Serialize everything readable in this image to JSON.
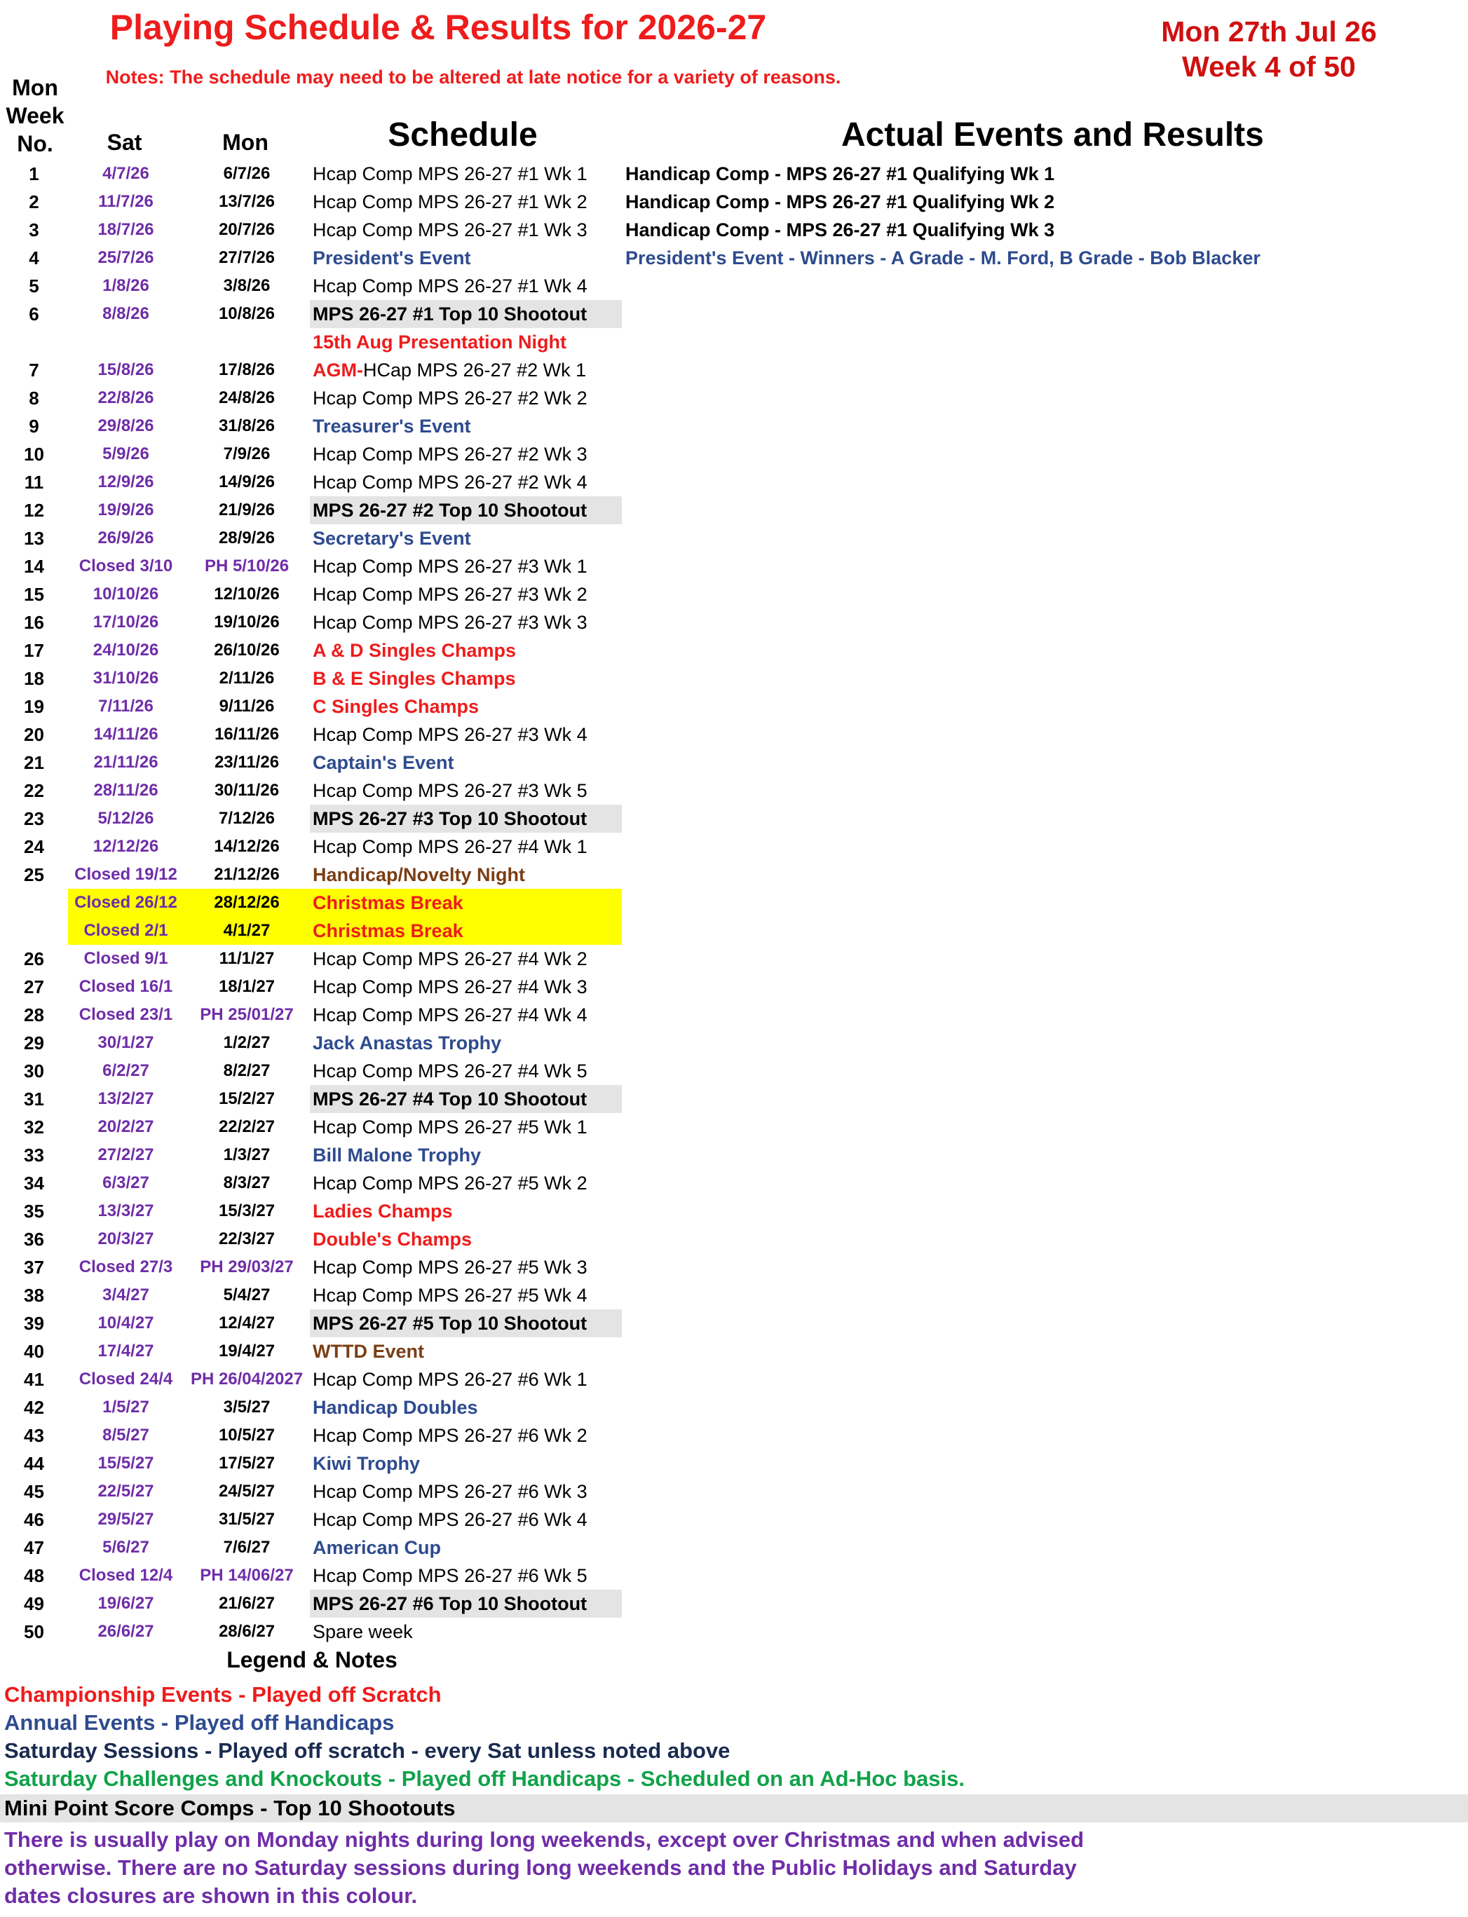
{
  "header": {
    "title": "Playing Schedule & Results for 2026-27",
    "notes": "Notes: The schedule may need to be altered at late notice for a variety of reasons.",
    "date_line1": "Mon 27th Jul 26",
    "date_line2": "Week 4 of 50"
  },
  "columns": {
    "week": "Mon Week No.",
    "sat": "Sat",
    "mon": "Mon",
    "schedule": "Schedule",
    "results": "Actual Events and Results"
  },
  "colors": {
    "championship": "#ee1c1c",
    "annual": "#2e4b8f",
    "saturday_sessions": "#1a2b50",
    "challenges": "#11a24a",
    "closures": "#6f2da8",
    "highlight_grey": "#e4e4e4",
    "highlight_yellow": "#ffff00"
  },
  "rows": [
    {
      "wk": "1",
      "sat": "4/7/26",
      "mon": "6/7/26",
      "sch": "Hcap Comp MPS 26-27 #1 Wk 1",
      "sch_style": "normal",
      "res": "Handicap Comp - MPS 26-27 #1 Qualifying Wk 1",
      "res_style": "bold"
    },
    {
      "wk": "2",
      "sat": "11/7/26",
      "mon": "13/7/26",
      "sch": "Hcap Comp MPS 26-27 #1 Wk 2",
      "sch_style": "normal",
      "res": "Handicap Comp - MPS 26-27 #1 Qualifying Wk 2",
      "res_style": "bold"
    },
    {
      "wk": "3",
      "sat": "18/7/26",
      "mon": "20/7/26",
      "sch": "Hcap Comp MPS 26-27 #1 Wk 3",
      "sch_style": "normal",
      "res": "Handicap Comp - MPS 26-27 #1 Qualifying Wk 3",
      "res_style": "bold"
    },
    {
      "wk": "4",
      "sat": "25/7/26",
      "mon": "27/7/26",
      "sch": "President's Event",
      "sch_style": "blue",
      "res": "President's Event - Winners - A Grade - M. Ford, B Grade - Bob Blacker",
      "res_style": "blue"
    },
    {
      "wk": "5",
      "sat": "1/8/26",
      "mon": "3/8/26",
      "sch": "Hcap Comp MPS 26-27 #1 Wk 4",
      "sch_style": "normal",
      "res": "",
      "res_style": "bold"
    },
    {
      "wk": "6",
      "sat": "8/8/26",
      "mon": "10/8/26",
      "sch": "MPS 26-27 #1 Top 10 Shootout",
      "sch_style": "bold",
      "hl": "grey",
      "res": "",
      "res_style": "bold"
    },
    {
      "wk": "",
      "sat": "",
      "mon": "",
      "sch": "15th Aug Presentation Night",
      "sch_style": "red",
      "res": "",
      "res_style": "bold"
    },
    {
      "wk": "7",
      "sat": "15/8/26",
      "mon": "17/8/26",
      "sch": "AGM-",
      "sch_style": "red",
      "sch2": "HCap MPS 26-27 #2 Wk 1",
      "res": "",
      "res_style": "bold"
    },
    {
      "wk": "8",
      "sat": "22/8/26",
      "mon": "24/8/26",
      "sch": "Hcap Comp MPS 26-27 #2 Wk 2",
      "sch_style": "normal",
      "res": "",
      "res_style": "bold"
    },
    {
      "wk": "9",
      "sat": "29/8/26",
      "mon": "31/8/26",
      "sch": "Treasurer's Event",
      "sch_style": "blue",
      "res": "",
      "res_style": "bold"
    },
    {
      "wk": "10",
      "sat": "5/9/26",
      "mon": "7/9/26",
      "sch": "Hcap Comp MPS 26-27 #2 Wk 3",
      "sch_style": "normal",
      "res": "",
      "res_style": "bold"
    },
    {
      "wk": "11",
      "sat": "12/9/26",
      "mon": "14/9/26",
      "sch": "Hcap Comp MPS 26-27 #2 Wk 4",
      "sch_style": "normal",
      "res": "",
      "res_style": "bold"
    },
    {
      "wk": "12",
      "sat": "19/9/26",
      "mon": "21/9/26",
      "sch": "MPS 26-27 #2 Top 10 Shootout",
      "sch_style": "bold",
      "hl": "grey",
      "res": "",
      "res_style": "bold"
    },
    {
      "wk": "13",
      "sat": "26/9/26",
      "mon": "28/9/26",
      "sch": "Secretary's Event",
      "sch_style": "blue",
      "res": "",
      "res_style": "bold"
    },
    {
      "wk": "14",
      "sat": "Closed 3/10",
      "mon": "PH 5/10/26",
      "mon_style": "purple",
      "sch": "Hcap Comp MPS 26-27 #3 Wk 1",
      "sch_style": "normal",
      "res": "",
      "res_style": "bold"
    },
    {
      "wk": "15",
      "sat": "10/10/26",
      "mon": "12/10/26",
      "sch": "Hcap Comp MPS 26-27 #3 Wk 2",
      "sch_style": "normal",
      "res": "",
      "res_style": "bold"
    },
    {
      "wk": "16",
      "sat": "17/10/26",
      "mon": "19/10/26",
      "sch": "Hcap Comp MPS 26-27 #3 Wk 3",
      "sch_style": "normal",
      "res": "",
      "res_style": "bold"
    },
    {
      "wk": "17",
      "sat": "24/10/26",
      "mon": "26/10/26",
      "sch": "A & D Singles Champs",
      "sch_style": "red",
      "res": "",
      "res_style": "bold"
    },
    {
      "wk": "18",
      "sat": "31/10/26",
      "mon": "2/11/26",
      "sch": "B & E Singles Champs",
      "sch_style": "red",
      "res": "",
      "res_style": "bold"
    },
    {
      "wk": "19",
      "sat": "7/11/26",
      "mon": "9/11/26",
      "sch": "C Singles Champs",
      "sch_style": "red",
      "res": "",
      "res_style": "bold"
    },
    {
      "wk": "20",
      "sat": "14/11/26",
      "mon": "16/11/26",
      "sch": "Hcap Comp MPS 26-27 #3 Wk 4",
      "sch_style": "normal",
      "res": "",
      "res_style": "bold"
    },
    {
      "wk": "21",
      "sat": "21/11/26",
      "mon": "23/11/26",
      "sch": "Captain's Event",
      "sch_style": "blue",
      "res": "",
      "res_style": "bold"
    },
    {
      "wk": "22",
      "sat": "28/11/26",
      "mon": "30/11/26",
      "sch": "Hcap Comp MPS 26-27 #3 Wk 5",
      "sch_style": "normal",
      "res": "",
      "res_style": "bold"
    },
    {
      "wk": "23",
      "sat": "5/12/26",
      "mon": "7/12/26",
      "sch": "MPS 26-27 #3 Top 10 Shootout",
      "sch_style": "bold",
      "hl": "grey",
      "res": "",
      "res_style": "bold"
    },
    {
      "wk": "24",
      "sat": "12/12/26",
      "mon": "14/12/26",
      "sch": "Hcap Comp MPS 26-27 #4 Wk 1",
      "sch_style": "normal",
      "res": "",
      "res_style": "bold"
    },
    {
      "wk": "25",
      "sat": "Closed 19/12",
      "mon": "21/12/26",
      "sch": "Handicap/Novelty Night",
      "sch_style": "brown",
      "res": "",
      "res_style": "bold"
    },
    {
      "wk": "",
      "sat": "Closed 26/12",
      "mon": "28/12/26",
      "sch": "Christmas Break",
      "sch_style": "red",
      "hl": "yellow",
      "res": "",
      "res_style": "bold"
    },
    {
      "wk": "",
      "sat": "Closed 2/1",
      "mon": "4/1/27",
      "sch": "Christmas Break",
      "sch_style": "red",
      "hl": "yellow",
      "res": "",
      "res_style": "bold"
    },
    {
      "wk": "26",
      "sat": "Closed 9/1",
      "mon": "11/1/27",
      "sch": "Hcap Comp MPS 26-27 #4 Wk 2",
      "sch_style": "normal",
      "res": "",
      "res_style": "bold"
    },
    {
      "wk": "27",
      "sat": "Closed 16/1",
      "mon": "18/1/27",
      "sch": "Hcap Comp MPS 26-27 #4 Wk 3",
      "sch_style": "normal",
      "res": "",
      "res_style": "bold"
    },
    {
      "wk": "28",
      "sat": "Closed 23/1",
      "mon": "PH 25/01/27",
      "mon_style": "purple",
      "sch": "Hcap Comp MPS 26-27 #4 Wk 4",
      "sch_style": "normal",
      "res": "",
      "res_style": "bold"
    },
    {
      "wk": "29",
      "sat": "30/1/27",
      "mon": "1/2/27",
      "sch": "Jack Anastas Trophy",
      "sch_style": "blue",
      "res": "",
      "res_style": "bold"
    },
    {
      "wk": "30",
      "sat": "6/2/27",
      "mon": "8/2/27",
      "sch": "Hcap Comp MPS 26-27 #4 Wk 5",
      "sch_style": "normal",
      "res": "",
      "res_style": "bold"
    },
    {
      "wk": "31",
      "sat": "13/2/27",
      "mon": "15/2/27",
      "sch": "MPS 26-27 #4 Top 10 Shootout",
      "sch_style": "bold",
      "hl": "grey",
      "res": "",
      "res_style": "bold"
    },
    {
      "wk": "32",
      "sat": "20/2/27",
      "mon": "22/2/27",
      "sch": "Hcap Comp MPS 26-27 #5 Wk 1",
      "sch_style": "normal",
      "res": "",
      "res_style": "bold"
    },
    {
      "wk": "33",
      "sat": "27/2/27",
      "mon": "1/3/27",
      "sch": "Bill Malone Trophy",
      "sch_style": "blue",
      "res": "",
      "res_style": "bold"
    },
    {
      "wk": "34",
      "sat": "6/3/27",
      "mon": "8/3/27",
      "sch": "Hcap Comp MPS 26-27 #5 Wk 2",
      "sch_style": "normal",
      "res": "",
      "res_style": "bold"
    },
    {
      "wk": "35",
      "sat": "13/3/27",
      "mon": "15/3/27",
      "sch": "Ladies Champs",
      "sch_style": "red",
      "res": "",
      "res_style": "bold"
    },
    {
      "wk": "36",
      "sat": "20/3/27",
      "mon": "22/3/27",
      "sch": "Double's Champs",
      "sch_style": "red",
      "res": "",
      "res_style": "bold"
    },
    {
      "wk": "37",
      "sat": "Closed 27/3",
      "mon": "PH 29/03/27",
      "mon_style": "purple",
      "sch": "Hcap Comp MPS 26-27 #5 Wk 3",
      "sch_style": "normal",
      "res": "",
      "res_style": "bold"
    },
    {
      "wk": "38",
      "sat": "3/4/27",
      "mon": "5/4/27",
      "sch": "Hcap Comp MPS 26-27 #5 Wk 4",
      "sch_style": "normal",
      "res": "",
      "res_style": "bold"
    },
    {
      "wk": "39",
      "sat": "10/4/27",
      "mon": "12/4/27",
      "sch": "MPS 26-27 #5 Top 10 Shootout",
      "sch_style": "bold",
      "hl": "grey",
      "res": "",
      "res_style": "bold"
    },
    {
      "wk": "40",
      "sat": "17/4/27",
      "mon": "19/4/27",
      "sch": "WTTD Event",
      "sch_style": "brown",
      "res": "",
      "res_style": "bold"
    },
    {
      "wk": "41",
      "sat": "Closed 24/4",
      "mon": "PH 26/04/2027",
      "mon_style": "purple",
      "sch": "Hcap Comp MPS 26-27 #6 Wk 1",
      "sch_style": "normal",
      "res": "",
      "res_style": "bold"
    },
    {
      "wk": "42",
      "sat": "1/5/27",
      "mon": "3/5/27",
      "sch": "Handicap Doubles",
      "sch_style": "blue",
      "res": "",
      "res_style": "bold"
    },
    {
      "wk": "43",
      "sat": "8/5/27",
      "mon": "10/5/27",
      "sch": "Hcap Comp MPS 26-27 #6 Wk 2",
      "sch_style": "normal",
      "res": "",
      "res_style": "bold"
    },
    {
      "wk": "44",
      "sat": "15/5/27",
      "mon": "17/5/27",
      "sch": "Kiwi Trophy",
      "sch_style": "blue",
      "res": "",
      "res_style": "bold"
    },
    {
      "wk": "45",
      "sat": "22/5/27",
      "mon": "24/5/27",
      "sch": "Hcap Comp MPS 26-27 #6 Wk 3",
      "sch_style": "normal",
      "res": "",
      "res_style": "bold"
    },
    {
      "wk": "46",
      "sat": "29/5/27",
      "mon": "31/5/27",
      "sch": "Hcap Comp MPS 26-27 #6 Wk 4",
      "sch_style": "normal",
      "res": "",
      "res_style": "bold"
    },
    {
      "wk": "47",
      "sat": "5/6/27",
      "mon": "7/6/27",
      "sch": "American Cup",
      "sch_style": "blue",
      "res": "",
      "res_style": "bold"
    },
    {
      "wk": "48",
      "sat": "Closed 12/4",
      "mon": "PH 14/06/27",
      "mon_style": "purple",
      "sch": "Hcap Comp MPS 26-27 #6 Wk 5",
      "sch_style": "normal",
      "res": "",
      "res_style": "bold"
    },
    {
      "wk": "49",
      "sat": "19/6/27",
      "mon": "21/6/27",
      "sch": "MPS 26-27 #6 Top 10 Shootout",
      "sch_style": "bold",
      "hl": "grey",
      "res": "",
      "res_style": "bold"
    },
    {
      "wk": "50",
      "sat": "26/6/27",
      "mon": "28/6/27",
      "sch": "Spare week",
      "sch_style": "normal",
      "res": "",
      "res_style": "bold"
    }
  ],
  "legend": {
    "title": "Legend & Notes",
    "championship": "Championship Events - Played off Scratch",
    "annual": "Annual Events - Played off Handicaps",
    "saturday": "Saturday Sessions - Played off scratch - every Sat unless noted above",
    "challenges": "Saturday Challenges and Knockouts - Played off Handicaps - Scheduled on an Ad-Hoc basis.",
    "mini": "Mini Point Score Comps - Top 10 Shootouts",
    "note": "There is usually play on Monday nights during long weekends, except over Christmas and when advised otherwise. There are no Saturday sessions during long weekends and the Public Holidays and Saturday dates closures are shown in this colour."
  }
}
